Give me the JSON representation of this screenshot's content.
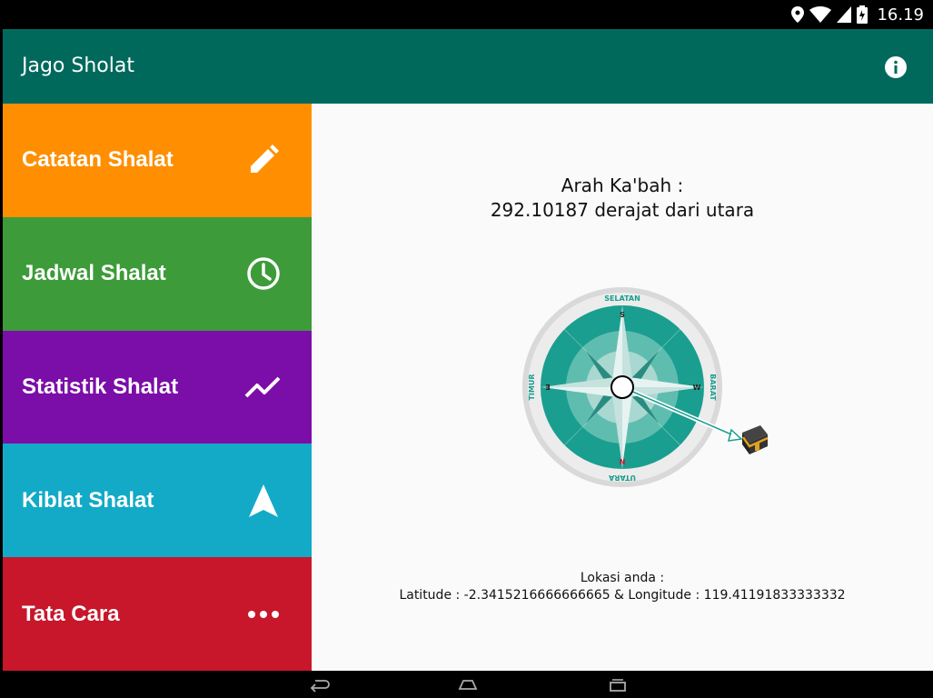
{
  "status_bar": {
    "time": "16.19",
    "icons": [
      "location-icon",
      "wifi-icon",
      "signal-icon",
      "battery-icon"
    ]
  },
  "app_bar": {
    "title": "Jago Sholat",
    "info_icon": "info-icon"
  },
  "menu": [
    {
      "label": "Catatan Shalat",
      "icon": "pencil-icon",
      "color": "#ff8f00"
    },
    {
      "label": "Jadwal Shalat",
      "icon": "clock-icon",
      "color": "#3d9b3a"
    },
    {
      "label": "Statistik Shalat",
      "icon": "trending-icon",
      "color": "#7b0da8"
    },
    {
      "label": "Kiblat Shalat",
      "icon": "navigation-arrow-icon",
      "color": "#13aac7"
    },
    {
      "label": "Tata Cara",
      "icon": "more-dots-icon",
      "color": "#c8162a"
    }
  ],
  "qibla": {
    "title": "Arah Ka'bah :",
    "value": "292.10187 derajat dari utara",
    "compass": {
      "top": "SELATAN",
      "right": "BARAT",
      "bottom": "UTARA",
      "left": "TIMUR",
      "s": "S",
      "w": "W",
      "n": "N",
      "e": "E"
    }
  },
  "location": {
    "label": "Lokasi anda :",
    "value": "Latitude : -2.3415216666666665 & Longitude : 119.41191833333332"
  },
  "nav_bar": {
    "buttons": [
      "back-icon",
      "home-icon",
      "recents-icon"
    ]
  },
  "colors": {
    "app_bar": "#00695c",
    "content_bg": "#fafafa",
    "compass_teal": "#1a9e8f"
  }
}
